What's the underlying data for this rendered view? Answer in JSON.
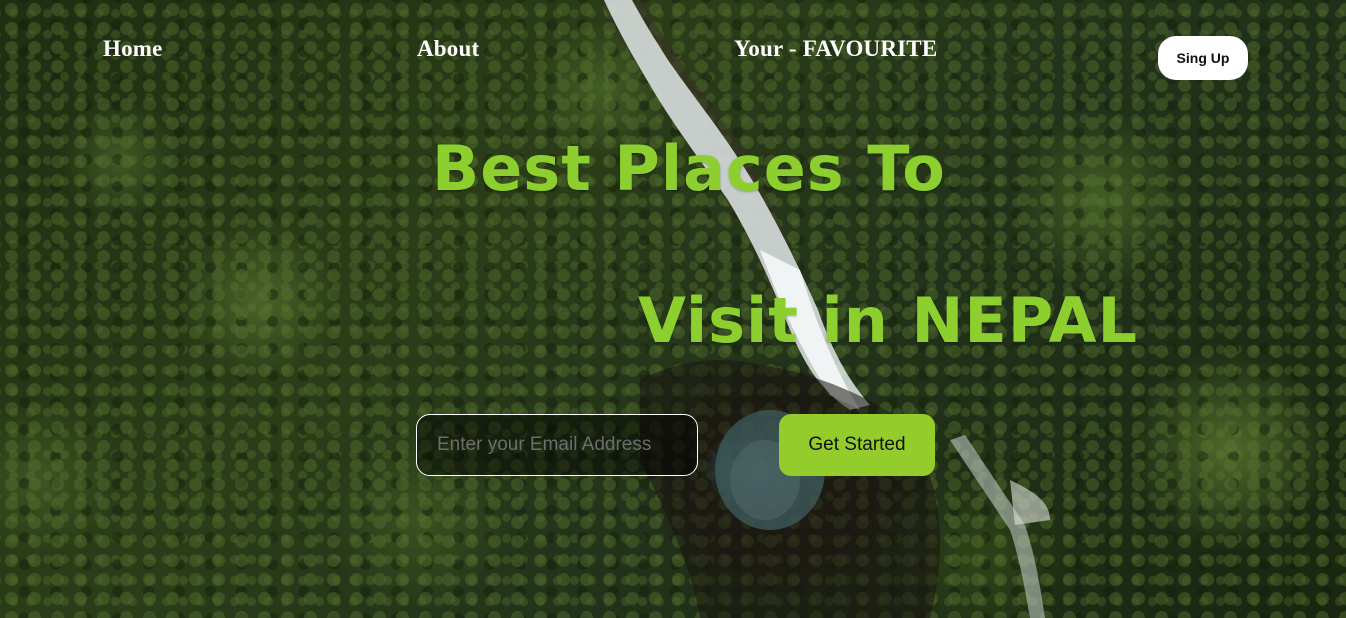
{
  "nav": {
    "home": "Home",
    "about": "About",
    "favourite": "Your - FAVOURITE",
    "signup": "Sing Up"
  },
  "hero": {
    "line1": "Best Places To",
    "line2": "Visit in NEPAL",
    "background_image": "aerial-forest-waterfall-photo"
  },
  "form": {
    "email_placeholder": "Enter your Email Address",
    "email_value": "",
    "cta_label": "Get Started"
  },
  "colors": {
    "headline": "#8ccf2e",
    "cta": "#94cd2b",
    "nav_text": "#ffffff"
  }
}
